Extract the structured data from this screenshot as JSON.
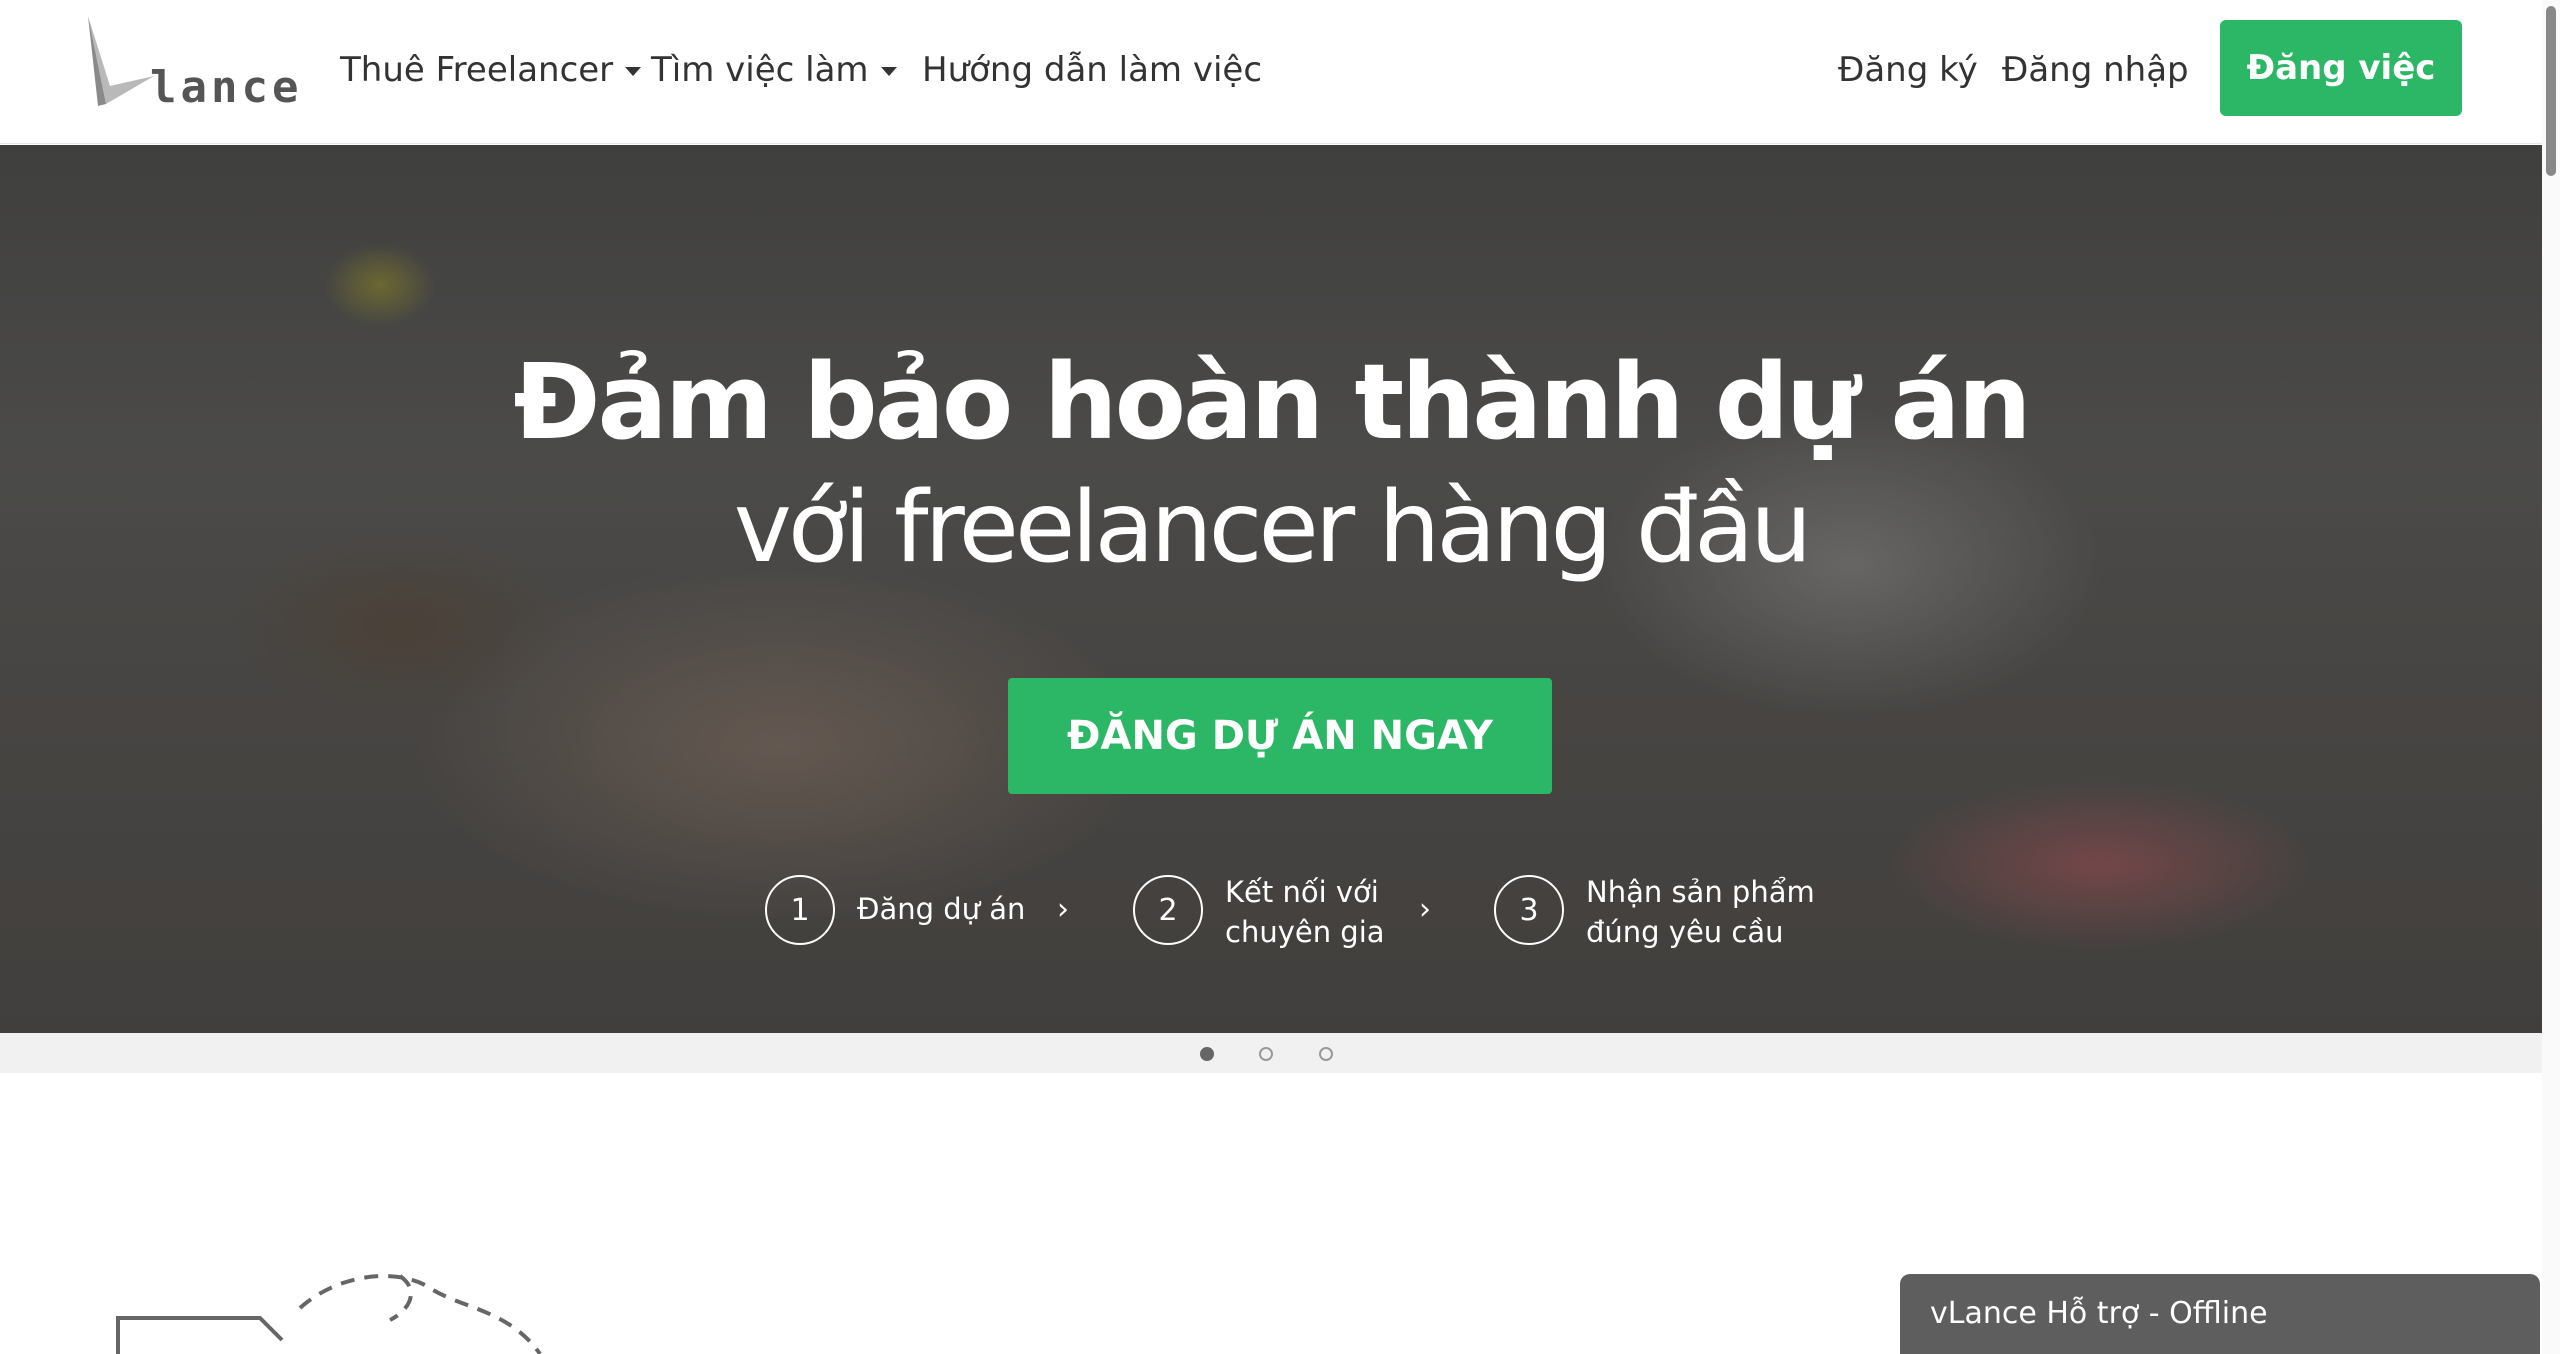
{
  "brand": {
    "logo_text": "lance",
    "accent": "#2bb765"
  },
  "nav": {
    "hire_freelancer": "Thuê Freelancer",
    "find_job": "Tìm việc làm",
    "guide": "Hướng dẫn làm việc",
    "register": "Đăng ký",
    "login": "Đăng nhập",
    "post_job": "Đăng việc"
  },
  "hero": {
    "title": "Đảm bảo hoàn thành dự án",
    "subtitle": "với freelancer hàng đầu",
    "cta": "ĐĂNG DỰ ÁN NGAY",
    "steps": [
      {
        "num": "1",
        "line1": "Đăng dự án",
        "line2": ""
      },
      {
        "num": "2",
        "line1": "Kết nối với",
        "line2": "chuyên gia"
      },
      {
        "num": "3",
        "line1": "Nhận sản phẩm",
        "line2": "đúng yêu cầu"
      }
    ],
    "step_arrow": "›"
  },
  "carousel": {
    "active_slide": 1,
    "slide_count": 3
  },
  "chat": {
    "label": "vLance Hỗ trợ - Offline"
  }
}
